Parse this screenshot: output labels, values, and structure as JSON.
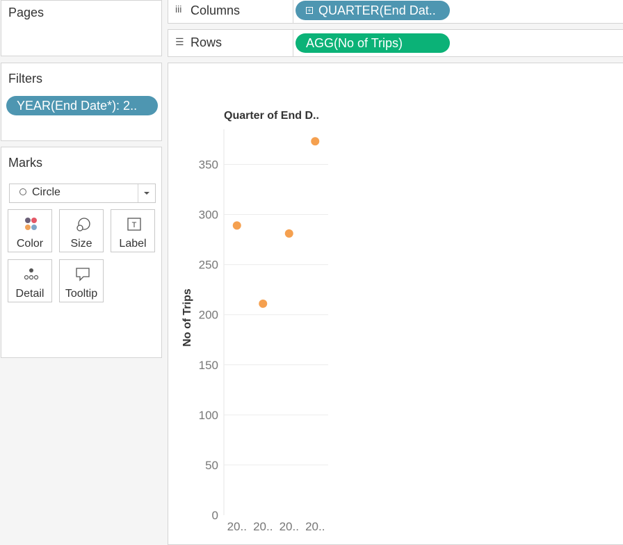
{
  "pages": {
    "title": "Pages"
  },
  "filters": {
    "title": "Filters",
    "pill": "YEAR(End Date*): 2.."
  },
  "marks": {
    "title": "Marks",
    "type_value": "Circle",
    "buttons": {
      "color": "Color",
      "size": "Size",
      "label": "Label",
      "detail": "Detail",
      "tooltip": "Tooltip"
    }
  },
  "shelves": {
    "columns_label": "Columns",
    "columns_pill": "QUARTER(End Dat..",
    "rows_label": "Rows",
    "rows_pill": "AGG(No of Trips)"
  },
  "colors": {
    "dimension_pill": "#4e96b1",
    "measure_pill": "#0bb277",
    "mark": "#f5a04f"
  },
  "chart_data": {
    "type": "scatter",
    "title": "Quarter of End D..",
    "xlabel": "",
    "ylabel": "No of Trips",
    "categories": [
      "20..",
      "20..",
      "20..",
      "20.."
    ],
    "values": [
      289,
      211,
      281,
      373
    ],
    "ylim": [
      0,
      385
    ],
    "yticks": [
      0,
      50,
      100,
      150,
      200,
      250,
      300,
      350
    ],
    "grid": true
  }
}
